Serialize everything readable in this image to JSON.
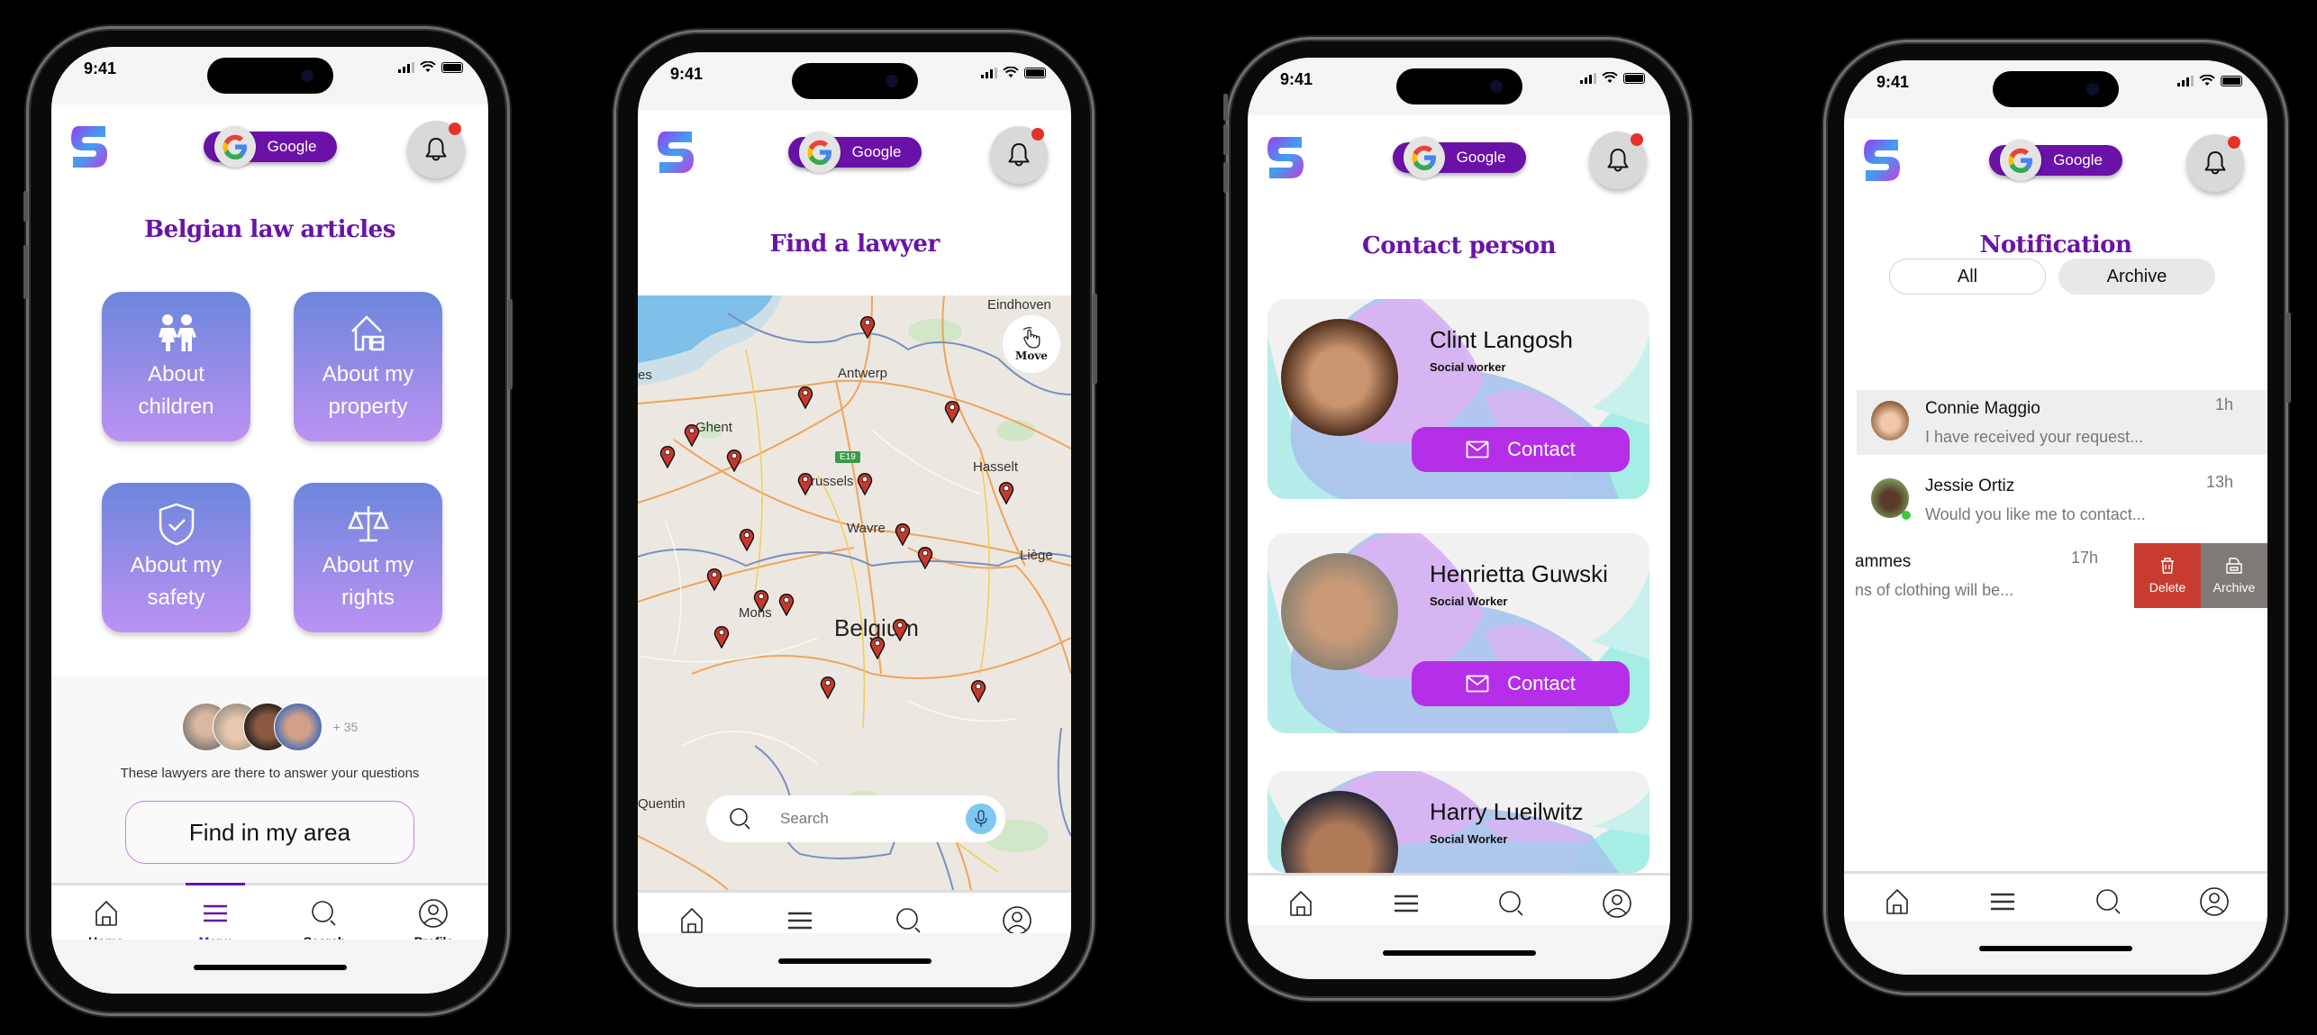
{
  "common": {
    "status_time": "9:41",
    "google_label": "Google",
    "tabs": [
      {
        "label": "Home",
        "icon": "home-icon"
      },
      {
        "label": "Menu",
        "icon": "menu-icon"
      },
      {
        "label": "Search",
        "icon": "search-icon"
      },
      {
        "label": "Profile",
        "icon": "profile-icon"
      }
    ],
    "colors": {
      "brand_purple": "#6a14a6",
      "accent_magenta": "#b52fe8",
      "notification_dot": "#e53228",
      "delete_red": "#c83c30",
      "archive_gray": "#7e7a78"
    }
  },
  "screen1": {
    "title": "Belgian law articles",
    "active_tab": "Menu",
    "categories": [
      {
        "label_line1": "About",
        "label_line2": "children",
        "icon": "children-icon"
      },
      {
        "label_line1": "About my",
        "label_line2": "property",
        "icon": "house-icon"
      },
      {
        "label_line1": "About my",
        "label_line2": "safety",
        "icon": "shield-check-icon"
      },
      {
        "label_line1": "About my",
        "label_line2": "rights",
        "icon": "scales-icon"
      }
    ],
    "lawyers_extra_count": "+ 35",
    "lawyers_text": "These lawyers are there to answer your questions",
    "find_button": "Find in my area"
  },
  "screen2": {
    "title": "Find a lawyer",
    "map_labels": [
      "Eindhoven",
      "Antwerp",
      "Ghent",
      "Brussels",
      "Hasselt",
      "Wavre",
      "Liège",
      "Mons",
      "Belgium",
      "Quentin",
      "es"
    ],
    "road_badge": "E19",
    "move_label": "Move",
    "search_placeholder": "Search"
  },
  "screen3": {
    "title": "Contact person",
    "contacts": [
      {
        "name": "Clint Langosh",
        "role": "Social worker",
        "button": "Contact"
      },
      {
        "name": "Henrietta Guwski",
        "role": "Social Worker",
        "button": "Contact"
      },
      {
        "name": "Harry Lueilwitz",
        "role": "Social Worker",
        "button": "Contact"
      }
    ]
  },
  "screen4": {
    "title": "Notification",
    "segments": [
      "All",
      "Archive"
    ],
    "notifications": [
      {
        "name": "Connie Maggio",
        "message": "I have received your request...",
        "time": "1h"
      },
      {
        "name": "Jessie Ortiz",
        "message": "Would you like me to contact...",
        "time": "13h",
        "online": true
      },
      {
        "name": "ammes",
        "message": "ns of clothing will be...",
        "time": "17h"
      }
    ],
    "swipe_actions": [
      "Delete",
      "Archive"
    ]
  }
}
